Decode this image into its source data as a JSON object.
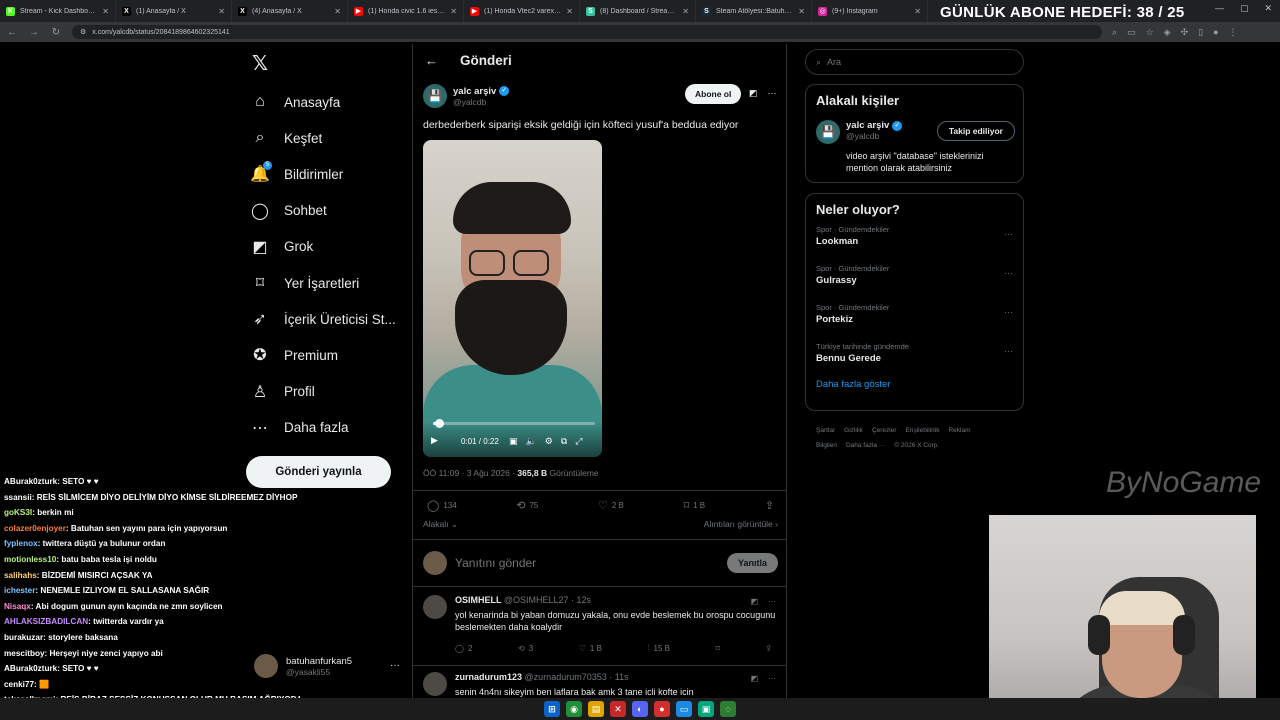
{
  "browser": {
    "tabs": [
      {
        "label": "Stream - Kick Dashboard",
        "fav": "K",
        "color": "#53fc18"
      },
      {
        "label": "(1) Anasayfa / X",
        "fav": "X",
        "color": "#000000"
      },
      {
        "label": "(4) Anasayfa / X",
        "fav": "X",
        "color": "#000000"
      },
      {
        "label": "(1) Honda civic 1.6 ies marş",
        "fav": "▶",
        "color": "#ff0000"
      },
      {
        "label": "(1) Honda Vtec2 varex egzoz ve",
        "fav": "▶",
        "color": "#ff0000"
      },
      {
        "label": "(8) Dashboard / Streamlabs",
        "fav": "S",
        "color": "#31c3a2"
      },
      {
        "label": "Steam Atölyesi::Batuhanfurkan",
        "fav": "S",
        "color": "#1b2838"
      },
      {
        "label": "(9+) Instagram",
        "fav": "◎",
        "color": "#d6249f"
      }
    ],
    "url": "x.com/yalcdb/status/2084189864602325141"
  },
  "overlay": {
    "goal_text": "GÜNLÜK ABONE HEDEFİ: 38 / 25",
    "brand": "ByNoGame"
  },
  "nav": {
    "items": [
      {
        "label": "Anasayfa",
        "icon": "home-icon",
        "glyph": "⌂"
      },
      {
        "label": "Keşfet",
        "icon": "search-icon",
        "glyph": "⌕"
      },
      {
        "label": "Bildirimler",
        "icon": "bell-icon",
        "glyph": "🔔",
        "badge": "5"
      },
      {
        "label": "Sohbet",
        "icon": "chat-icon",
        "glyph": "◯"
      },
      {
        "label": "Grok",
        "icon": "grok-icon",
        "glyph": "◩"
      },
      {
        "label": "Yer İşaretleri",
        "icon": "bookmark-icon",
        "glyph": "⌑"
      },
      {
        "label": "İçerik Üreticisi St...",
        "icon": "rocket-icon",
        "glyph": "➶"
      },
      {
        "label": "Premium",
        "icon": "premium-icon",
        "glyph": "✪"
      },
      {
        "label": "Profil",
        "icon": "profile-icon",
        "glyph": "♙"
      },
      {
        "label": "Daha fazla",
        "icon": "more-circle-icon",
        "glyph": "⋯"
      }
    ],
    "post_button": "Gönderi yayınla",
    "account": {
      "name": "batuhanfurkan5",
      "handle": "@yasakli55"
    }
  },
  "main": {
    "header_title": "Gönderi",
    "post": {
      "author": "yalc arşiv",
      "handle": "@yalcdb",
      "subscribe": "Abone ol",
      "text": "derbederberk siparişi eksik geldiği için köfteci yusuf'a beddua ediyor",
      "video_time": "0:01 / 0:22",
      "video_progress": 0.04,
      "meta_time": "ÖÖ 11:09 · 3 Ağu 2026 · ",
      "views": "365,8 B",
      "views_label": " Görüntüleme",
      "stats": {
        "replies": "134",
        "reposts": "75",
        "likes": "2 B",
        "bookmarks": "1 B"
      },
      "related_left": "Alakalı",
      "related_right": "Alıntıları görüntüle"
    },
    "reply_placeholder": "Yanıtını gönder",
    "reply_button": "Yanıtla",
    "comments": [
      {
        "name": "OSIMHELL",
        "handle": "@OSIMHELL27 · 12s",
        "text": "yol kenarinda bi yaban domuzu yakala, onu evde beslemek bu orospu cocugunu beslemekten daha koalydir",
        "replies": "2",
        "reposts": "3",
        "likes": "1 B",
        "views": "15 B"
      },
      {
        "name": "zurnadurum123",
        "handle": "@zurnadurum70353 · 11s",
        "text": "senin 4n4nı sikeyim ben laflara bak amk 3 tane icli kofte icin",
        "replies": "",
        "reposts": "",
        "likes": "",
        "views": ""
      }
    ]
  },
  "right": {
    "search_placeholder": "Ara",
    "related_title": "Alakalı kişiler",
    "related_person": {
      "name": "yalc arşiv",
      "handle": "@yalcdb",
      "button": "Takip ediliyor",
      "bio": "video arşivi \"database\" isteklerinizi mention olarak atabilirsiniz"
    },
    "trends_title": "Neler oluyor?",
    "trends": [
      {
        "context": "Spor · Gündemdekiler",
        "title": "Lookman"
      },
      {
        "context": "Spor · Gündemdekiler",
        "title": "Gulrassy"
      },
      {
        "context": "Spor · Gündemdekiler",
        "title": "Portekiz"
      },
      {
        "context": "Türkiye tarihinde gündemde",
        "title": "Bennu Gerede"
      }
    ],
    "show_more": "Daha fazla göster",
    "footer": [
      "Şartlar",
      "Gizlilik",
      "Çerezler",
      "Erişilebilirlik",
      "Reklam Bilgileri",
      "Daha fazla ···",
      "© 2026 X Corp."
    ]
  },
  "chat": [
    {
      "user": "ABurak0zturk",
      "color": "#ffffff",
      "msg": ": SETO ♥ ♥"
    },
    {
      "user": "ssansii",
      "color": "#ffffff",
      "msg": ": REİS SİLMİCEM DİYO DELİYİM DİYO KİMSE SİLDİREEMEZ DİYHOP"
    },
    {
      "user": "goKS3I",
      "color": "#b9f27c",
      "msg": ": berkin mi"
    },
    {
      "user": "colazer0enjoyer",
      "color": "#ff7b3a",
      "msg": ": Batuhan sen yayını para için yapıyorsun"
    },
    {
      "user": "fyplenox",
      "color": "#7cc4ff",
      "msg": ": twittera düştü ya bulunur ordan"
    },
    {
      "user": "motionless10",
      "color": "#b9f27c",
      "msg": ": batu baba tesla işi noldu"
    },
    {
      "user": "salihahs",
      "color": "#ffd36b",
      "msg": ": BİZDEMİ MISIRCI AÇSAK YA"
    },
    {
      "user": "ichester",
      "color": "#7cc4ff",
      "msg": ": NENEMLE IZLIYOM EL SALLASANA SAĞIR"
    },
    {
      "user": "Nisaqx",
      "color": "#ff8fd6",
      "msg": ": Abi dogum gunun ayın kaçında ne zmn soylicen"
    },
    {
      "user": "AHLAKSIZBADILCAN",
      "color": "#c58bff",
      "msg": ": twitterda vardır ya"
    },
    {
      "user": "burakuzar",
      "color": "#ffffff",
      "msg": ": storylere baksana"
    },
    {
      "user": "mescitboy",
      "color": "#ffffff",
      "msg": ": Herşeyi niye zenci yapıyo abi"
    },
    {
      "user": "ABurak0zturk",
      "color": "#ffffff",
      "msg": ": SETO ♥ ♥"
    },
    {
      "user": "cenki77",
      "color": "#ffffff",
      "msg": ": 🟧"
    },
    {
      "user": "teksasllmami",
      "color": "#ffffff",
      "msg": ": REİS BİRAZ SESSİZ KONUŞSAN OLUR MU BAŞIM AĞRIYODA"
    }
  ],
  "colors": {
    "accent": "#1d9bf0",
    "background": "#000000",
    "border": "#2f3336",
    "muted": "#71767b"
  }
}
